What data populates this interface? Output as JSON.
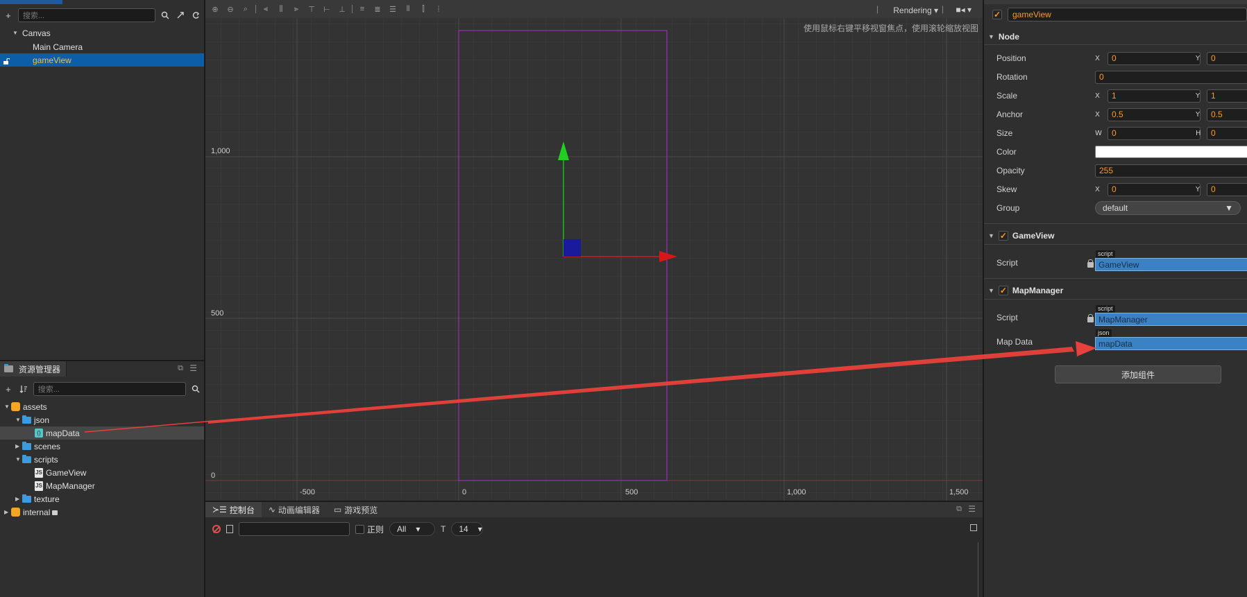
{
  "hierarchy": {
    "search_placeholder": "搜索...",
    "items": [
      {
        "label": "Canvas"
      },
      {
        "label": "Main Camera"
      },
      {
        "label": "gameView"
      }
    ]
  },
  "assets": {
    "tab_label": "资源管理器",
    "search_placeholder": "搜索...",
    "items": [
      {
        "label": "assets"
      },
      {
        "label": "json"
      },
      {
        "label": "mapData"
      },
      {
        "label": "scenes"
      },
      {
        "label": "scripts"
      },
      {
        "label": "GameView"
      },
      {
        "label": "MapManager"
      },
      {
        "label": "texture"
      },
      {
        "label": "internal"
      }
    ]
  },
  "scene": {
    "rendering_label": "Rendering",
    "hint": "使用鼠标右键平移视窗焦点，使用滚轮缩放视图",
    "y_ticks": [
      "1,000",
      "500",
      "0"
    ],
    "x_ticks": [
      "-500",
      "0",
      "500",
      "1,000",
      "1,500"
    ]
  },
  "console": {
    "tabs": [
      {
        "label": "控制台"
      },
      {
        "label": "动画编辑器"
      },
      {
        "label": "游戏预览"
      }
    ],
    "regex_label": "正则",
    "filter_value": "All",
    "font_size": "14"
  },
  "inspector": {
    "node_name": "gameView",
    "node_section": "Node",
    "props": {
      "position_label": "Position",
      "position_x": "0",
      "position_y": "0",
      "rotation_label": "Rotation",
      "rotation": "0",
      "scale_label": "Scale",
      "scale_x": "1",
      "scale_y": "1",
      "anchor_label": "Anchor",
      "anchor_x": "0.5",
      "anchor_y": "0.5",
      "size_label": "Size",
      "size_w": "0",
      "size_h": "0",
      "color_label": "Color",
      "opacity_label": "Opacity",
      "opacity": "255",
      "skew_label": "Skew",
      "skew_x": "0",
      "skew_y": "0",
      "group_label": "Group",
      "group": "default"
    },
    "axis": {
      "x": "X",
      "y": "Y",
      "w": "W",
      "h": "H"
    },
    "gameview_component": {
      "title": "GameView",
      "script_label": "Script",
      "tag": "script",
      "value": "GameView"
    },
    "mapmanager_component": {
      "title": "MapManager",
      "script_label": "Script",
      "script_tag": "script",
      "script_value": "MapManager",
      "mapdata_label": "Map Data",
      "mapdata_tag": "json",
      "mapdata_value": "mapData"
    },
    "add_component": "添加组件"
  },
  "colors": {
    "accent_orange": "#ff9a1a",
    "selection_blue": "#0c5ea8",
    "asset_field_blue": "#3a82c4",
    "annotation_red": "#e8403a"
  }
}
